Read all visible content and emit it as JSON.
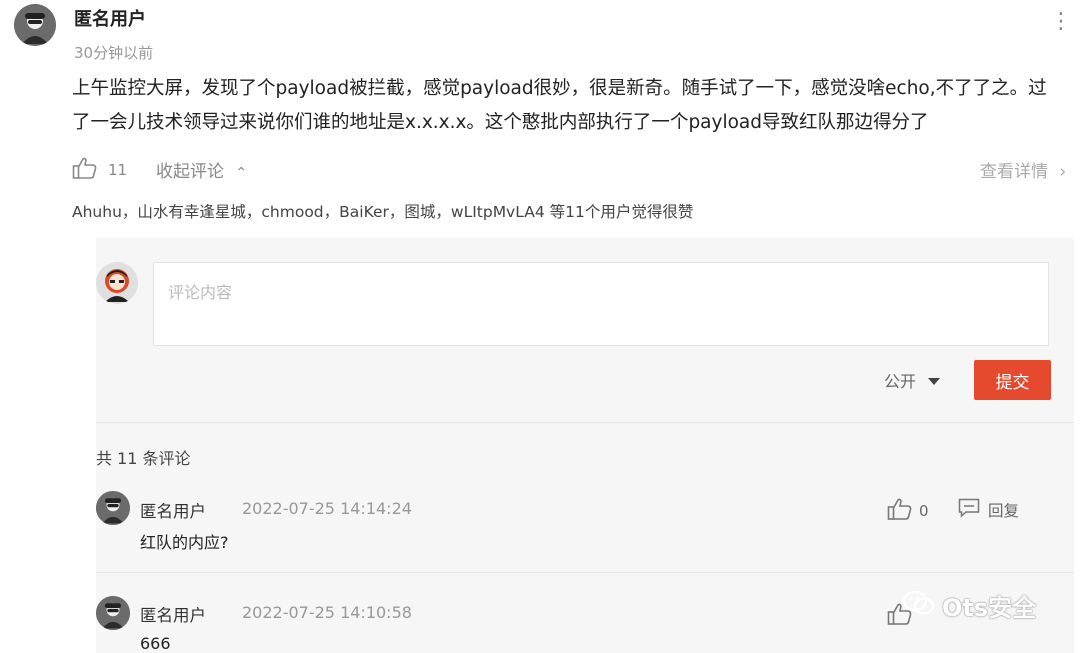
{
  "post": {
    "author": "匿名用户",
    "time": "30分钟以前",
    "body": "上午监控大屏，发现了个payload被拦截，感觉payload很妙，很是新奇。随手试了一下，感觉没啥echo,不了了之。过了一会儿技术领导过来说你们谁的地址是x.x.x.x。这个憨批内部执行了一个payload导致红队那边得分了",
    "like_count": "11",
    "collapse_label": "收起评论",
    "view_detail_label": "查看详情",
    "likers": "Ahuhu，山水有幸逢星城，chmood，BaiKer，图城，wLItpMvLA4 等11个用户觉得很赞"
  },
  "compose": {
    "placeholder": "评论内容",
    "visibility": "公开",
    "submit_label": "提交"
  },
  "comments_header": "共 11 条评论",
  "comments": [
    {
      "author": "匿名用户",
      "time": "2022-07-25 14:14:24",
      "text": "红队的内应?",
      "likes": "0",
      "reply_label": "回复"
    },
    {
      "author": "匿名用户",
      "time": "2022-07-25 14:10:58",
      "text": "666"
    }
  ],
  "watermark": "Ots安全",
  "colors": {
    "accent": "#e64a2e",
    "panel": "#f6f6f6"
  }
}
